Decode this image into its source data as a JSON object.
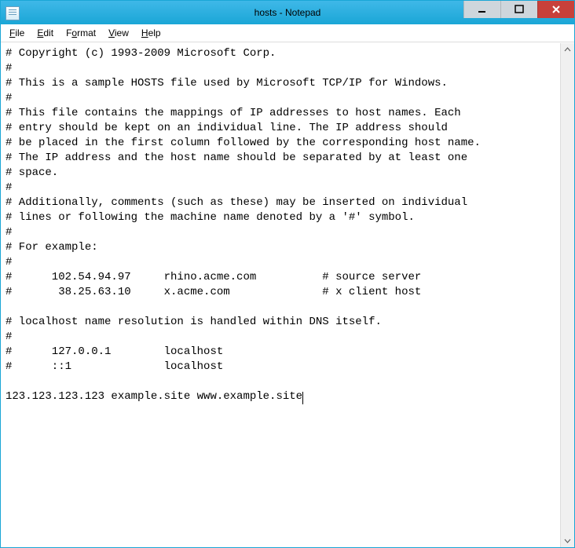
{
  "window": {
    "title": "hosts - Notepad"
  },
  "menu": {
    "file": "File",
    "edit": "Edit",
    "format": "Format",
    "view": "View",
    "help": "Help"
  },
  "editor": {
    "content": "# Copyright (c) 1993-2009 Microsoft Corp.\n#\n# This is a sample HOSTS file used by Microsoft TCP/IP for Windows.\n#\n# This file contains the mappings of IP addresses to host names. Each\n# entry should be kept on an individual line. The IP address should\n# be placed in the first column followed by the corresponding host name.\n# The IP address and the host name should be separated by at least one\n# space.\n#\n# Additionally, comments (such as these) may be inserted on individual\n# lines or following the machine name denoted by a '#' symbol.\n#\n# For example:\n#\n#      102.54.94.97     rhino.acme.com          # source server\n#       38.25.63.10     x.acme.com              # x client host\n\n# localhost name resolution is handled within DNS itself.\n#\n#      127.0.0.1        localhost\n#      ::1              localhost\n\n123.123.123.123 example.site www.example.site"
  }
}
